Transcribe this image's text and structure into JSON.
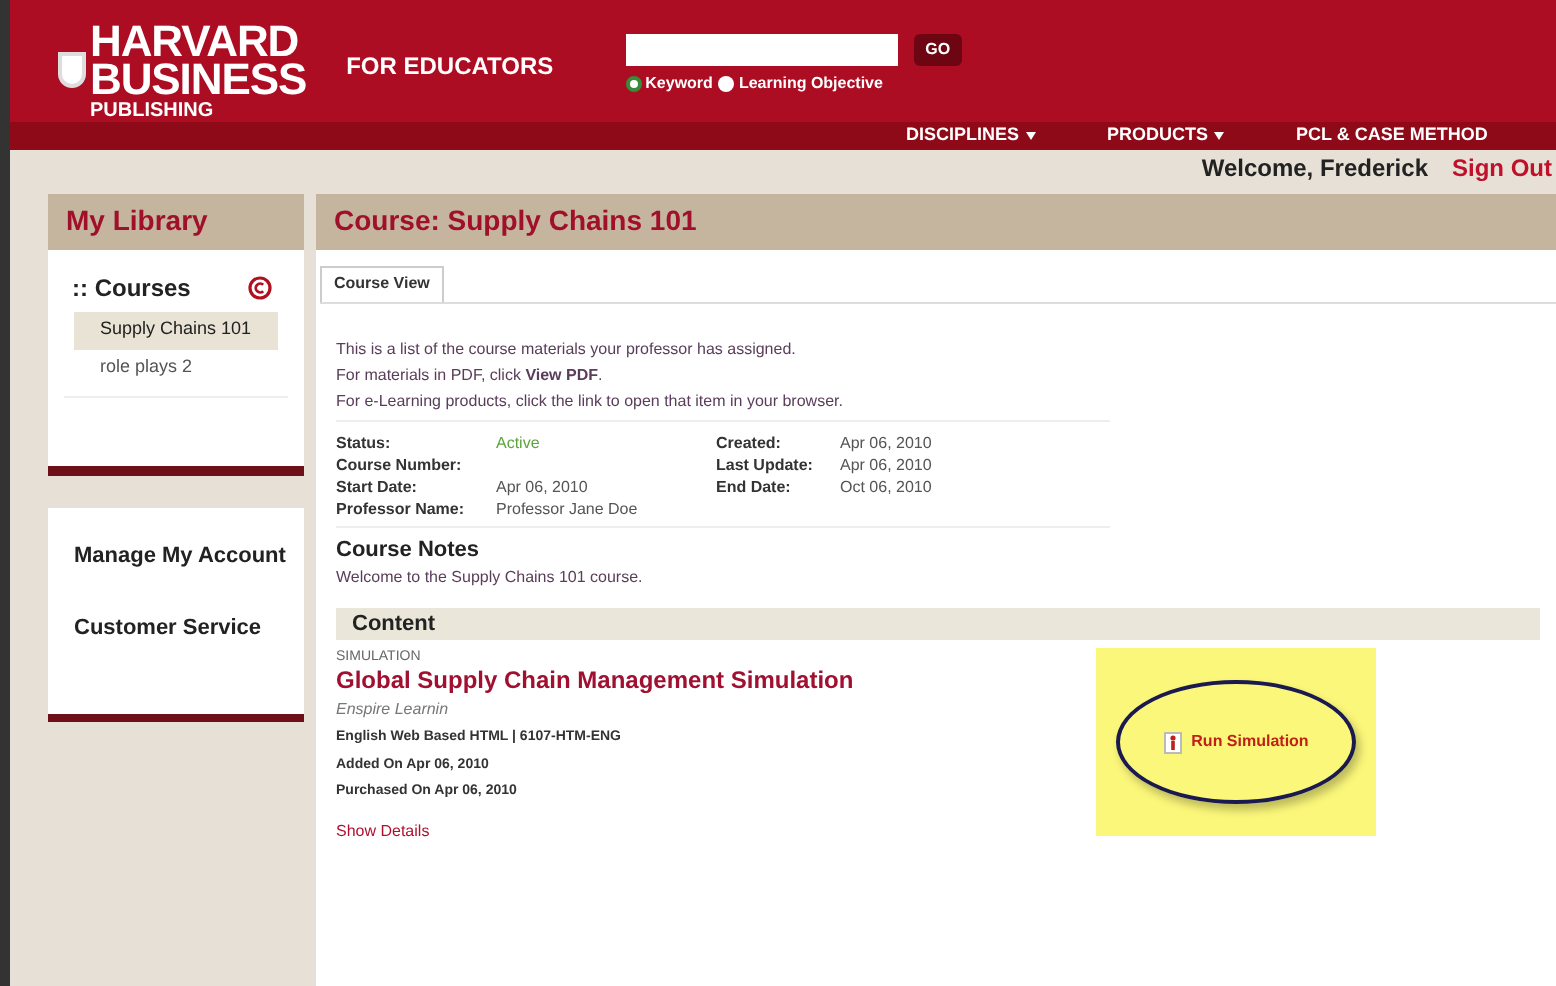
{
  "header": {
    "logo_lines": [
      "HARVARD",
      "BUSINESS",
      "PUBLISHING"
    ],
    "tagline": "FOR EDUCATORS",
    "search": {
      "button": "GO",
      "options": [
        {
          "label": "Keyword",
          "selected": true
        },
        {
          "label": "Learning Objective",
          "selected": false
        }
      ]
    }
  },
  "nav": [
    {
      "label": "DISCIPLINES",
      "dropdown": true
    },
    {
      "label": "PRODUCTS",
      "dropdown": true
    },
    {
      "label": "PCL & CASE METHOD",
      "dropdown": false
    }
  ],
  "user": {
    "welcome": "Welcome, Frederick",
    "sign_out": "Sign Out"
  },
  "sidebar": {
    "title": "My Library",
    "courses_title": ":: Courses",
    "courses": [
      {
        "label": "Supply Chains 101",
        "selected": true
      },
      {
        "label": "role plays 2",
        "selected": false
      }
    ],
    "links": [
      "Manage My Account",
      "Customer Service"
    ]
  },
  "main": {
    "title": "Course: Supply Chains 101",
    "tabs": [
      {
        "label": "Course View",
        "selected": true
      }
    ],
    "intro": [
      "This is a list of the course materials your professor has assigned.",
      "For materials in PDF, click **View PDF**.",
      "For e-Learning products, click the link to open that item in your browser."
    ],
    "details_left": [
      {
        "label": "Status:",
        "value": "Active",
        "kind": "status"
      },
      {
        "label": "Course Number:"
      },
      {
        "label": "Start Date:",
        "value": "Apr 06, 2010",
        "kind": "text"
      },
      {
        "label": "Professor Name:",
        "value": "Professor Jane Doe",
        "kind": "text"
      }
    ],
    "details_right": [
      {
        "label": "Created:",
        "value": "Apr 06, 2010"
      },
      {
        "label": "Last Update:",
        "value": "Apr 06, 2010"
      },
      {
        "label": "End Date:",
        "value": "Oct 06, 2010"
      }
    ],
    "notes_title": "Course Notes",
    "notes": "Welcome to the Supply Chains 101 course.",
    "content_title": "Content",
    "item": {
      "type": "SIMULATION",
      "title": "Global Supply Chain Management Simulation",
      "vendor": "Enspire Learnin",
      "format": "English Web Based HTML | 6107-HTM-ENG",
      "added": "Added On Apr 06, 2010",
      "purchased": "Purchased On Apr 06, 2010",
      "show_details": "Show Details",
      "action": "Run Simulation"
    }
  }
}
